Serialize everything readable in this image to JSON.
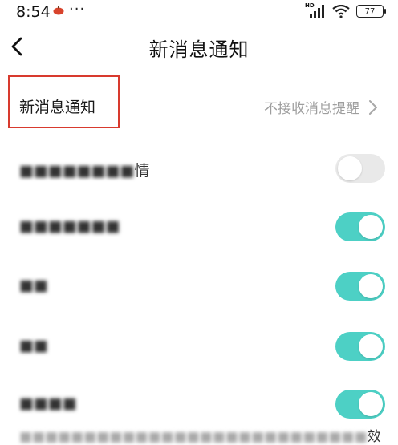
{
  "status_bar": {
    "time": "8:54",
    "more": "···",
    "hd": "HD",
    "battery": "77"
  },
  "header": {
    "back_icon": "chevron-left-icon",
    "title": "新消息通知"
  },
  "new_message_row": {
    "label": "新消息通知",
    "value": "不接收消息提醒",
    "chevron_icon": "chevron-right-icon"
  },
  "settings": [
    {
      "label_blurred": "■■■■■■■■",
      "label_tail": "情",
      "enabled": false
    },
    {
      "label_blurred": "■■■■■■■",
      "label_tail": "",
      "enabled": true
    },
    {
      "label_blurred": "■■",
      "label_tail": "",
      "enabled": true
    },
    {
      "label_blurred": "■■",
      "label_tail": "",
      "enabled": true
    },
    {
      "label_blurred": "■■■■",
      "label_tail": "",
      "enabled": true
    }
  ],
  "footnote": {
    "blurred": "■■■■■■■■■■■■■■■■■■■■■■■■■■■",
    "tail": "效"
  },
  "colors": {
    "accent": "#4dd0c5",
    "highlight": "#d83a2e",
    "toggle_off": "#e9e9e9"
  }
}
